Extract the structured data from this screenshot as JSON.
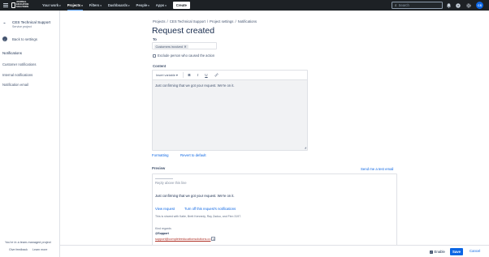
{
  "topbar": {
    "logo_text": "JOURNAL EDUCATION SOLUTIONS",
    "nav": [
      {
        "label": "Your work",
        "active": false
      },
      {
        "label": "Projects",
        "active": true
      },
      {
        "label": "Filters",
        "active": false
      },
      {
        "label": "Dashboards",
        "active": false
      },
      {
        "label": "People",
        "active": false
      },
      {
        "label": "Apps",
        "active": false
      }
    ],
    "create_label": "Create",
    "search_placeholder": "Search",
    "avatar_initials": "CS"
  },
  "sidebar": {
    "project_name": "CES Technical Support",
    "project_type": "Service project",
    "back_label": "Back to settings",
    "section_title": "Notifications",
    "items": [
      {
        "label": "Customer notifications"
      },
      {
        "label": "Internal notifications"
      },
      {
        "label": "Notification email"
      }
    ],
    "footer_text": "You're in a team-managed project",
    "footer_links": [
      "Give feedback",
      "Learn more"
    ]
  },
  "breadcrumb": [
    "Projects",
    "CES Technical Support",
    "Project settings",
    "Notifications"
  ],
  "page_title": "Request created",
  "to_label": "To",
  "to_chip": "Customers involved",
  "exclude_label": "Exclude person who caused the action",
  "content_label": "Content",
  "toolbar": {
    "insert_variable": "Insert variable",
    "bold": "B",
    "italic": "I",
    "underline": "U"
  },
  "content_text": "Just confirming that we got your request. We're on it.",
  "formatting_link": "Formatting",
  "revert_link": "Revert to default",
  "preview_label": "Preview",
  "send_test_link": "Send me a test email",
  "preview": {
    "reply_above": "Reply above this line",
    "message": "Just confirming that we got your request. We're on it.",
    "view_request": "View request",
    "turn_off": "Turn off this request's notifications",
    "shared_with": "This is shared with Katie, Brett Kennedy, Ray Zadou, and Finn 3197.",
    "regards": "Kind regards",
    "signature": "@Support",
    "email": "support@completeeducationsolutions.co"
  },
  "bottom": {
    "enable_label": "Enable",
    "enable_checked": true,
    "save_label": "Save",
    "cancel_label": "Cancel"
  }
}
